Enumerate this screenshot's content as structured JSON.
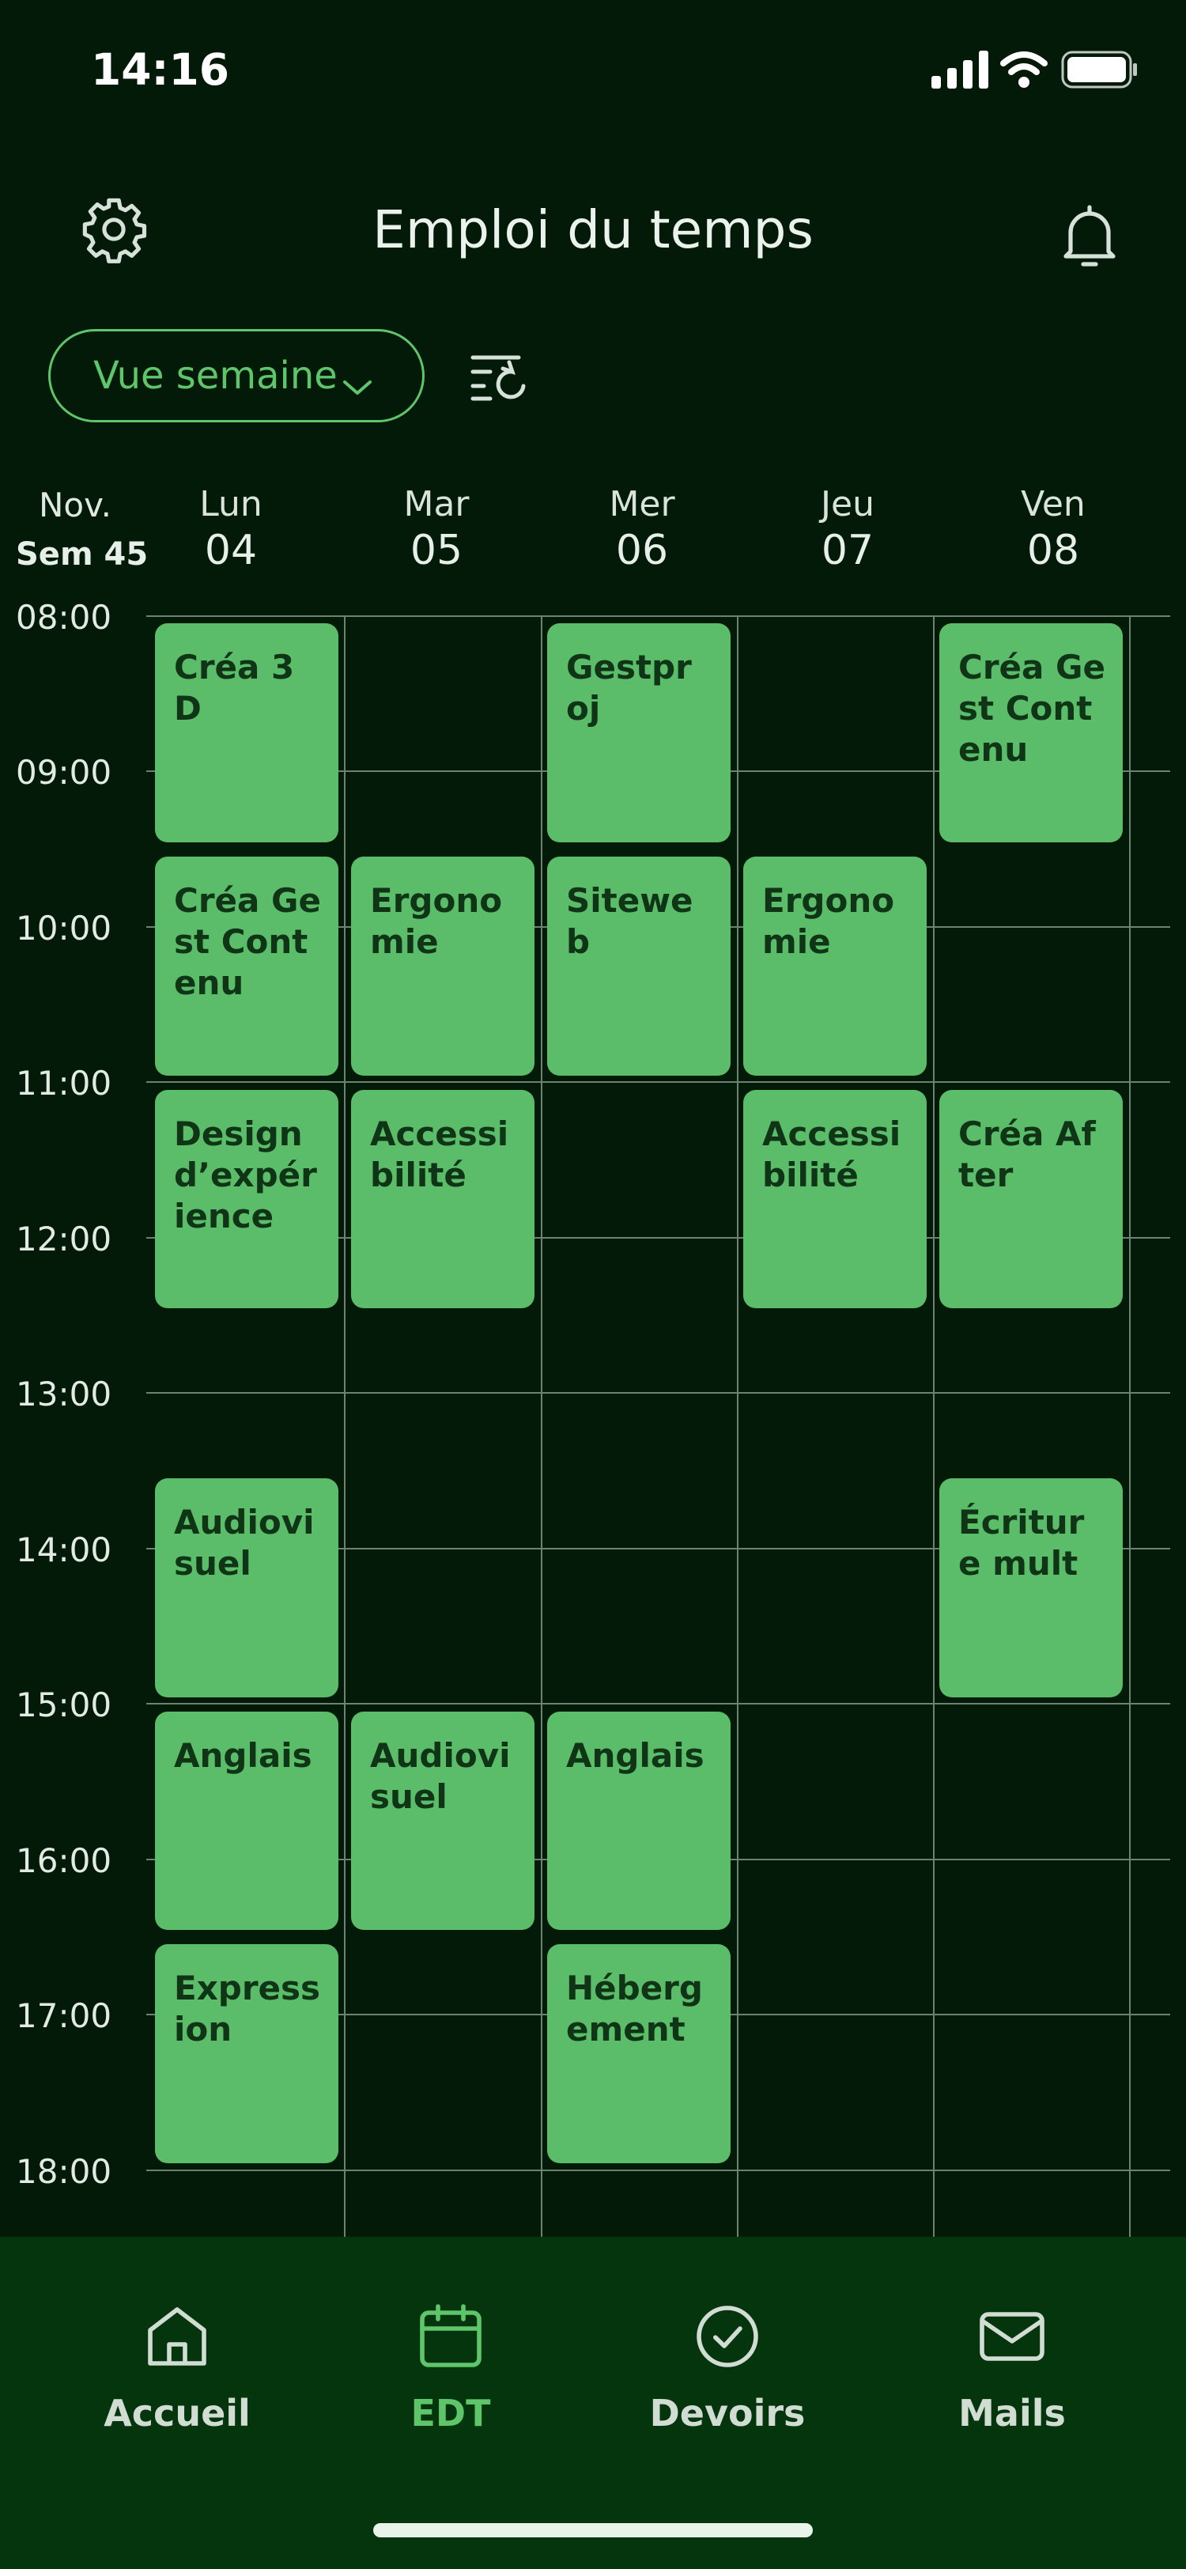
{
  "status_bar": {
    "time": "14:16"
  },
  "header": {
    "title": "Emploi du temps"
  },
  "view_selector": {
    "label": "Vue semaine"
  },
  "calendar": {
    "month": "Nov.",
    "week": "Sem 45",
    "days": [
      {
        "name": "Lun",
        "num": "04"
      },
      {
        "name": "Mar",
        "num": "05"
      },
      {
        "name": "Mer",
        "num": "06"
      },
      {
        "name": "Jeu",
        "num": "07"
      },
      {
        "name": "Ven",
        "num": "08"
      }
    ],
    "hours": [
      "08:00",
      "09:00",
      "10:00",
      "11:00",
      "12:00",
      "13:00",
      "14:00",
      "15:00",
      "16:00",
      "17:00",
      "18:00"
    ],
    "events": [
      {
        "day": 0,
        "start": 8.0,
        "end": 9.5,
        "title": "Créa 3D"
      },
      {
        "day": 2,
        "start": 8.0,
        "end": 9.5,
        "title": "Gestproj"
      },
      {
        "day": 4,
        "start": 8.0,
        "end": 9.5,
        "title": "Créa Gest Contenu"
      },
      {
        "day": 0,
        "start": 9.5,
        "end": 11.0,
        "title": "Créa Gest Contenu"
      },
      {
        "day": 1,
        "start": 9.5,
        "end": 11.0,
        "title": "Ergonomie"
      },
      {
        "day": 2,
        "start": 9.5,
        "end": 11.0,
        "title": "Siteweb"
      },
      {
        "day": 3,
        "start": 9.5,
        "end": 11.0,
        "title": "Ergonomie"
      },
      {
        "day": 0,
        "start": 11.0,
        "end": 12.5,
        "title": "Design d’expérience"
      },
      {
        "day": 1,
        "start": 11.0,
        "end": 12.5,
        "title": "Accessibilité"
      },
      {
        "day": 3,
        "start": 11.0,
        "end": 12.5,
        "title": "Accessibilité"
      },
      {
        "day": 4,
        "start": 11.0,
        "end": 12.5,
        "title": "Créa After"
      },
      {
        "day": 0,
        "start": 13.5,
        "end": 15.0,
        "title": "Audiovisuel"
      },
      {
        "day": 4,
        "start": 13.5,
        "end": 15.0,
        "title": "Écriture mult"
      },
      {
        "day": 0,
        "start": 15.0,
        "end": 16.5,
        "title": "Anglais"
      },
      {
        "day": 1,
        "start": 15.0,
        "end": 16.5,
        "title": "Audiovisuel"
      },
      {
        "day": 2,
        "start": 15.0,
        "end": 16.5,
        "title": "Anglais"
      },
      {
        "day": 0,
        "start": 16.5,
        "end": 18.0,
        "title": "Expression"
      },
      {
        "day": 2,
        "start": 16.5,
        "end": 18.0,
        "title": "Hébergement"
      }
    ]
  },
  "nav": {
    "items": [
      {
        "label": "Accueil",
        "icon": "home-icon"
      },
      {
        "label": "EDT",
        "icon": "calendar-icon"
      },
      {
        "label": "Devoirs",
        "icon": "check-circle-icon"
      },
      {
        "label": "Mails",
        "icon": "mail-icon"
      }
    ],
    "active": "EDT"
  },
  "colors": {
    "background": "#041a09",
    "accent": "#5ec56b",
    "event": "#5bbd6a",
    "nav_background": "#04350d"
  }
}
